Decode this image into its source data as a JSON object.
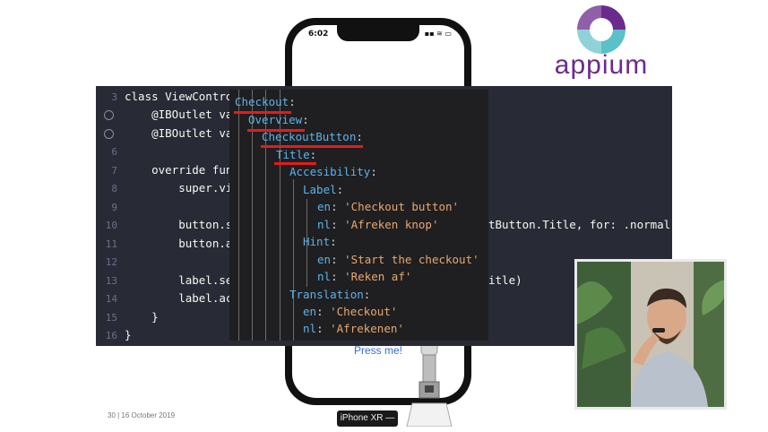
{
  "phone": {
    "time": "6:02",
    "status_icons": "▪▪ ≋ ▭",
    "button_label": "Press me!"
  },
  "device_label": "iPhone XR —",
  "slide_footer": "30 | 16 October 2019",
  "logo": {
    "wordmark": "appium"
  },
  "editor": {
    "lines": [
      {
        "num": "3",
        "text": "class ViewControlle"
      },
      {
        "num": "",
        "text": "    @IBOutlet var"
      },
      {
        "num": "",
        "text": "    @IBOutlet var"
      },
      {
        "num": "6",
        "text": ""
      },
      {
        "num": "7",
        "text": "    override func"
      },
      {
        "num": "8",
        "text": "        super.vie"
      },
      {
        "num": "9",
        "text": ""
      },
      {
        "num": "10",
        "text": "        button.se"
      },
      {
        "num": "11",
        "text": "        button.ac"
      },
      {
        "num": "12",
        "text": ""
      },
      {
        "num": "13",
        "text": "        label.set"
      },
      {
        "num": "14",
        "text": "        label.acc"
      },
      {
        "num": "15",
        "text": "    }"
      },
      {
        "num": "16",
        "text": "}"
      }
    ],
    "right_fragments": [
      {
        "text": "tButton.Title, for: .normal)"
      },
      {
        "text": "itle)"
      }
    ]
  },
  "yaml": {
    "lines": [
      {
        "key": "Checkout",
        "colon": ":",
        "value": ""
      },
      {
        "key": "Overview",
        "colon": ":",
        "value": ""
      },
      {
        "key": "CheckoutButton",
        "colon": ":",
        "value": ""
      },
      {
        "key": "Title",
        "colon": ":",
        "value": ""
      },
      {
        "key": "Accesibility",
        "colon": ":",
        "value": ""
      },
      {
        "key": "Label",
        "colon": ":",
        "value": ""
      },
      {
        "key": "en",
        "colon": ": ",
        "value": "'Checkout button'"
      },
      {
        "key": "nl",
        "colon": ": ",
        "value": "'Afreken knop'"
      },
      {
        "key": "Hint",
        "colon": ":",
        "value": ""
      },
      {
        "key": "en",
        "colon": ": ",
        "value": "'Start the checkout'"
      },
      {
        "key": "nl",
        "colon": ": ",
        "value": "'Reken af'"
      },
      {
        "key": "Translation",
        "colon": ":",
        "value": ""
      },
      {
        "key": "en",
        "colon": ": ",
        "value": "'Checkout'"
      },
      {
        "key": "nl",
        "colon": ": ",
        "value": "'Afrekenen'"
      }
    ]
  },
  "colors": {
    "underline": "#e31c1c",
    "yaml_key": "#5db2ea",
    "yaml_string": "#e8a86e",
    "editor_bg": "#282a36",
    "brand_purple": "#6a2a8e"
  }
}
